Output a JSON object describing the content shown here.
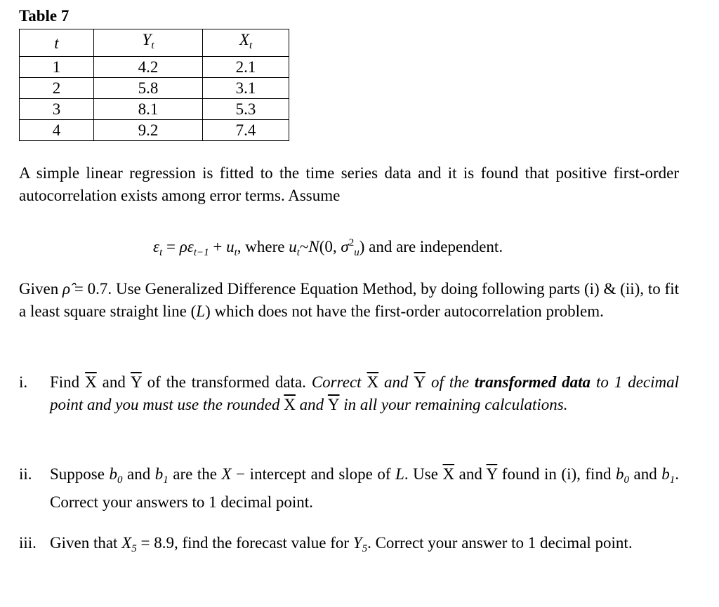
{
  "table": {
    "title": "Table 7",
    "headers": [
      [
        {
          "t": "t",
          "s": "i"
        }
      ],
      [
        {
          "t": "Y",
          "s": "i"
        },
        {
          "t": "t",
          "s": "sub"
        }
      ],
      [
        {
          "t": "X",
          "s": "i"
        },
        {
          "t": "t",
          "s": "sub"
        }
      ]
    ],
    "rows": [
      [
        "1",
        "4.2",
        "2.1"
      ],
      [
        "2",
        "5.8",
        "3.1"
      ],
      [
        "3",
        "8.1",
        "5.3"
      ],
      [
        "4",
        "9.2",
        "7.4"
      ]
    ]
  },
  "paragraphs": {
    "intro": [
      {
        "t": "A simple linear regression is fitted to the time series data and it is found that positive first-order autocorrelation exists among error terms. Assume",
        "s": ""
      }
    ],
    "equation": [
      {
        "t": "ε",
        "s": "i"
      },
      {
        "t": "t",
        "s": "sub"
      },
      {
        "t": " = ",
        "s": ""
      },
      {
        "t": "ρε",
        "s": "i"
      },
      {
        "t": "t−1",
        "s": "sub"
      },
      {
        "t": " + ",
        "s": ""
      },
      {
        "t": "u",
        "s": "i"
      },
      {
        "t": "t",
        "s": "sub"
      },
      {
        "t": ", where ",
        "s": ""
      },
      {
        "t": "u",
        "s": "i"
      },
      {
        "t": "t",
        "s": "sub"
      },
      {
        "t": "~",
        "s": ""
      },
      {
        "t": "N",
        "s": "i"
      },
      {
        "t": "(0, ",
        "s": ""
      },
      {
        "t": "σ",
        "s": "i"
      },
      {
        "t": "2",
        "s": "sup"
      },
      {
        "t": "u",
        "s": "sub"
      },
      {
        "t": ") and are independent.",
        "s": ""
      }
    ],
    "given": [
      {
        "t": "Given ",
        "s": ""
      },
      {
        "t": "ρ̂",
        "s": "i"
      },
      {
        "t": " = 0.7. Use Generalized Difference Equation Method, by doing following parts (i) & (ii), to fit a least square straight line (",
        "s": ""
      },
      {
        "t": "L",
        "s": "i"
      },
      {
        "t": ") which does not have the first-order autocorrelation problem.",
        "s": ""
      }
    ]
  },
  "items": [
    {
      "label": "i.",
      "segments": [
        {
          "t": "Find ",
          "s": ""
        },
        {
          "t": "X",
          "s": "bar"
        },
        {
          "t": " and ",
          "s": ""
        },
        {
          "t": "Y",
          "s": "bar"
        },
        {
          "t": " of the transformed data. ",
          "s": ""
        },
        {
          "t": "Correct ",
          "s": "i"
        },
        {
          "t": "X",
          "s": "bar"
        },
        {
          "t": " and ",
          "s": "i"
        },
        {
          "t": "Y",
          "s": "bar"
        },
        {
          "t": " of the ",
          "s": "i"
        },
        {
          "t": "transformed data",
          "s": "b"
        },
        {
          "t": " to 1 decimal point and you must use the rounded ",
          "s": "i"
        },
        {
          "t": "X",
          "s": "bar"
        },
        {
          "t": " and ",
          "s": "i"
        },
        {
          "t": "Y",
          "s": "bar"
        },
        {
          "t": " in all your remaining calculations.",
          "s": "i"
        }
      ]
    },
    {
      "label": "ii.",
      "segments": [
        {
          "t": "Suppose ",
          "s": ""
        },
        {
          "t": "b",
          "s": "i"
        },
        {
          "t": "0",
          "s": "sub"
        },
        {
          "t": " and ",
          "s": ""
        },
        {
          "t": "b",
          "s": "i"
        },
        {
          "t": "1",
          "s": "sub"
        },
        {
          "t": " are the ",
          "s": ""
        },
        {
          "t": "X",
          "s": "i"
        },
        {
          "t": " − intercept and slope of ",
          "s": ""
        },
        {
          "t": "L",
          "s": "i"
        },
        {
          "t": ". Use ",
          "s": ""
        },
        {
          "t": "X",
          "s": "bar"
        },
        {
          "t": " and ",
          "s": ""
        },
        {
          "t": "Y",
          "s": "bar"
        },
        {
          "t": " found in (i), find ",
          "s": ""
        },
        {
          "t": "b",
          "s": "i"
        },
        {
          "t": "0",
          "s": "sub"
        },
        {
          "t": " and ",
          "s": ""
        },
        {
          "t": "b",
          "s": "i"
        },
        {
          "t": "1",
          "s": "sub"
        },
        {
          "t": ". Correct your answers to 1 decimal point.",
          "s": ""
        }
      ]
    },
    {
      "label": "iii.",
      "segments": [
        {
          "t": "Given that ",
          "s": ""
        },
        {
          "t": "X",
          "s": "i"
        },
        {
          "t": "5",
          "s": "sub"
        },
        {
          "t": " = 8.9, find the forecast value for ",
          "s": ""
        },
        {
          "t": "Y",
          "s": "i"
        },
        {
          "t": "5",
          "s": "sub"
        },
        {
          "t": ". Correct your answer to 1 decimal point.",
          "s": ""
        }
      ]
    }
  ]
}
